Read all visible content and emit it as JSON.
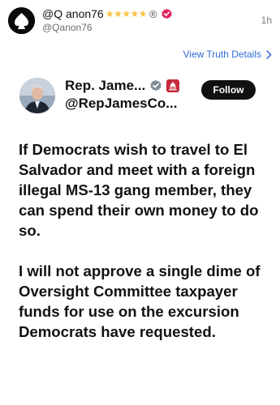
{
  "post": {
    "author_name": "@Q anon76",
    "stars": "★★★★★",
    "registered_mark": "®",
    "author_handle": "@Qanon76",
    "time": "1h",
    "details_link": "View Truth Details",
    "details_chevron": "›"
  },
  "quoted": {
    "name": "Rep. Jame...",
    "handle": "@RepJamesCo...",
    "follow_label": "Follow",
    "paragraphs": [
      "If Democrats wish to travel to El Salvador and meet with a foreign illegal MS-13 gang member, they can spend their own money to do so.",
      "I will not approve a single dime of Oversight Committee taxpayer funds for use on the excursion Democrats have requested."
    ]
  },
  "icons": {
    "top_avatar": "black-avatar-icon",
    "verified_pink": "verified-badge-icon",
    "chevron": "chevron-right-icon",
    "verified_gray": "verified-badge-icon",
    "capitol": "capitol-building-icon"
  },
  "colors": {
    "link": "#2e6bd6",
    "pink_badge": "#e0245e",
    "star": "#f6c343",
    "capitol_badge": "#c6293a",
    "follow_bg": "#111111"
  }
}
